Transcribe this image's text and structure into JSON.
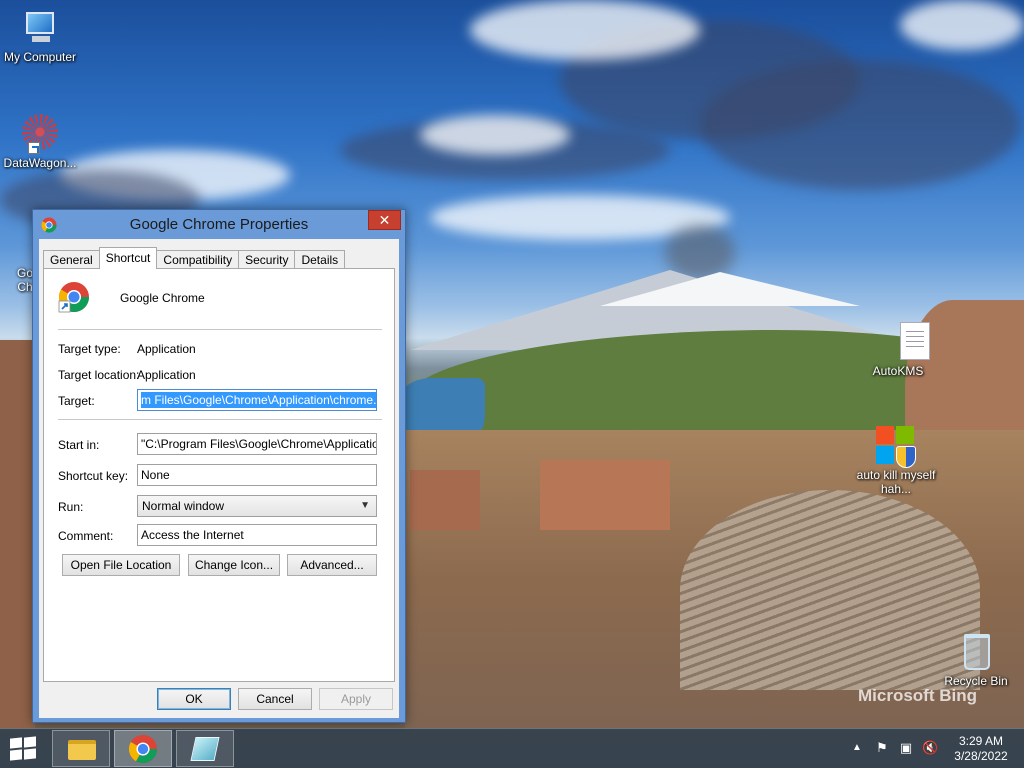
{
  "desktop": {
    "icons": [
      {
        "label": "My Computer"
      },
      {
        "label": "DataWagon..."
      },
      {
        "label": "AutoKMS"
      },
      {
        "label": "auto kill myself hah..."
      },
      {
        "label": "Recycle Bin"
      }
    ],
    "watermark": "Microsoft Bing",
    "partial_icon_label": "Go\nCh"
  },
  "dialog": {
    "title": "Google Chrome Properties",
    "close_glyph": "✕",
    "tabs": [
      {
        "label": "General",
        "active": false
      },
      {
        "label": "Shortcut",
        "active": true
      },
      {
        "label": "Compatibility",
        "active": false
      },
      {
        "label": "Security",
        "active": false
      },
      {
        "label": "Details",
        "active": false
      }
    ],
    "app_name": "Google Chrome",
    "target_type": {
      "label": "Target type:",
      "value": "Application"
    },
    "target_location": {
      "label": "Target location:",
      "value": "Application"
    },
    "target": {
      "label": "Target:",
      "value": "m Files\\Google\\Chrome\\Application\\chrome.exe\""
    },
    "start_in": {
      "label": "Start in:",
      "value": "\"C:\\Program Files\\Google\\Chrome\\Application\""
    },
    "shortcut_key": {
      "label": "Shortcut key:",
      "value": "None"
    },
    "run": {
      "label": "Run:",
      "value": "Normal window"
    },
    "comment": {
      "label": "Comment:",
      "value": "Access the Internet"
    },
    "buttons": {
      "open_file_location": "Open File Location",
      "change_icon": "Change Icon...",
      "advanced": "Advanced...",
      "ok": "OK",
      "cancel": "Cancel",
      "apply": "Apply"
    }
  },
  "taskbar": {
    "time": "3:29 AM",
    "date": "3/28/2022"
  },
  "colors": {
    "title_bar": "#6a9ad8",
    "close_button": "#c7402f",
    "selection": "#3399ff"
  }
}
